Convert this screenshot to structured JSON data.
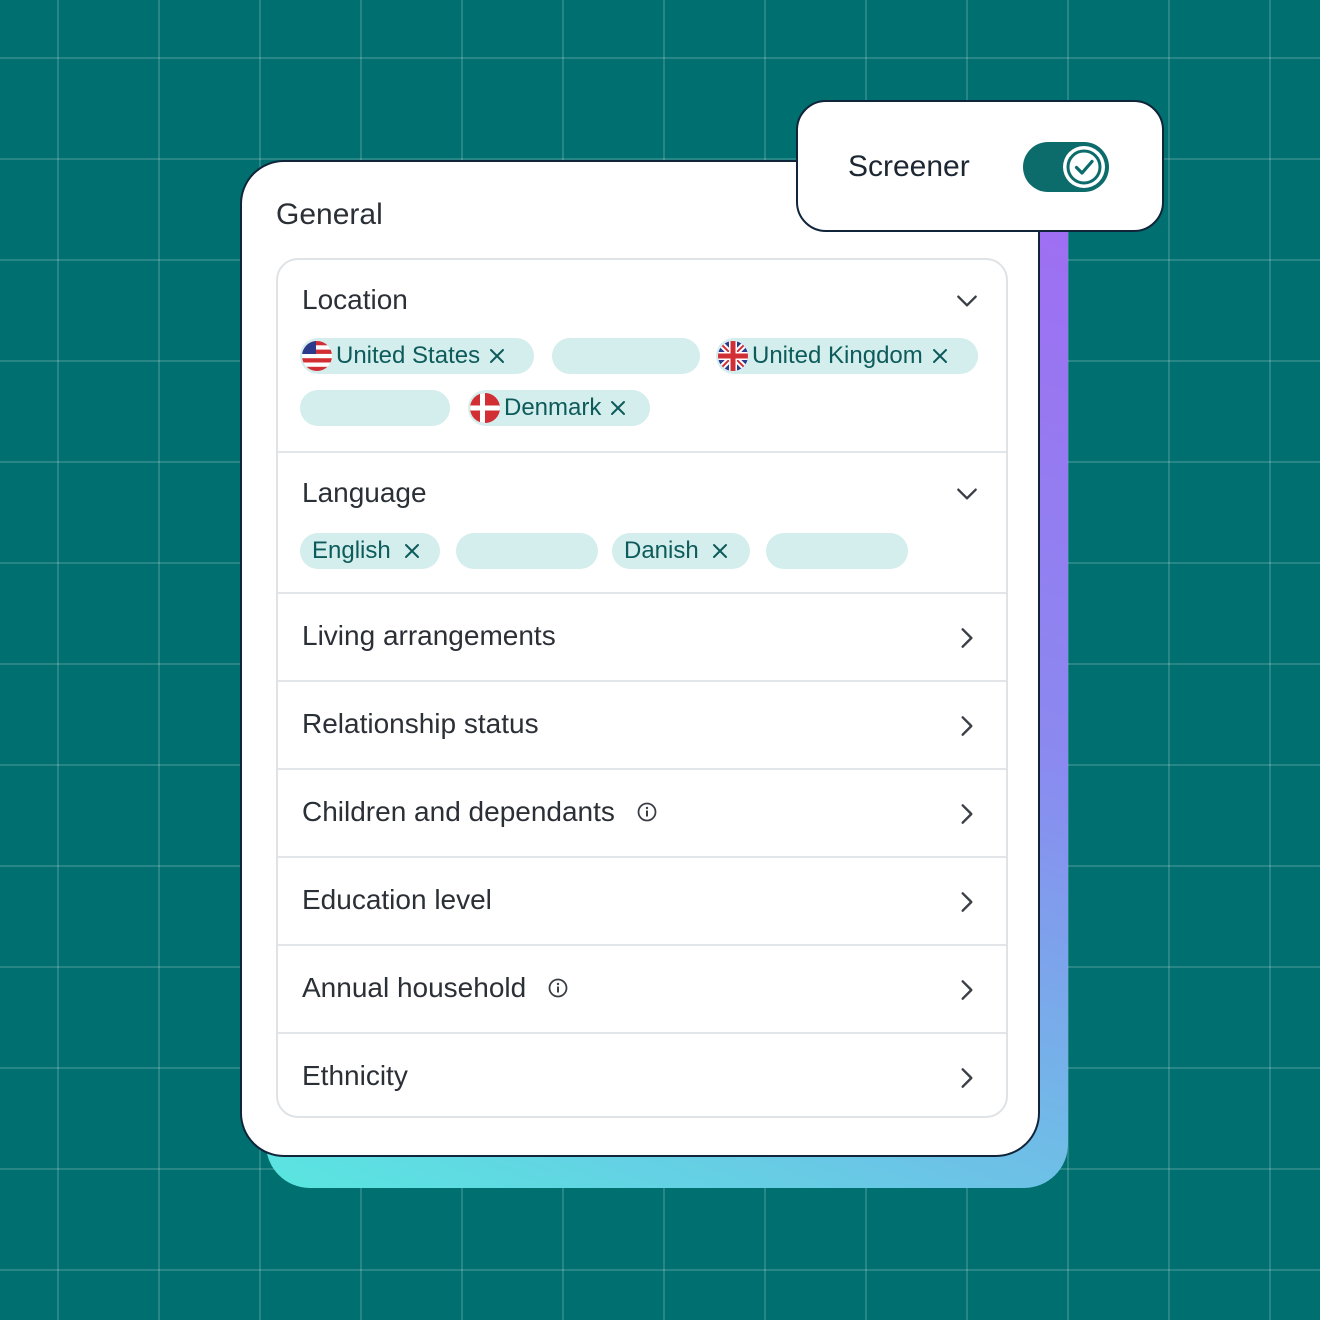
{
  "toggle": {
    "label": "Screener",
    "on": true
  },
  "card": {
    "title": "General",
    "location": {
      "label": "Location",
      "chips": [
        "United States",
        "United Kingdom",
        "Denmark"
      ]
    },
    "language": {
      "label": "Language",
      "chips": [
        "English",
        "Danish"
      ]
    },
    "rows": [
      "Living arrangements",
      "Relationship status",
      "Children and dependants",
      "Education level",
      "Annual household",
      "Ethnicity"
    ]
  },
  "colors": {
    "background": "#006f6f",
    "accent": "#0c6b6b",
    "chip": "#d3eeec",
    "chip_text": "#0e5b5b"
  }
}
